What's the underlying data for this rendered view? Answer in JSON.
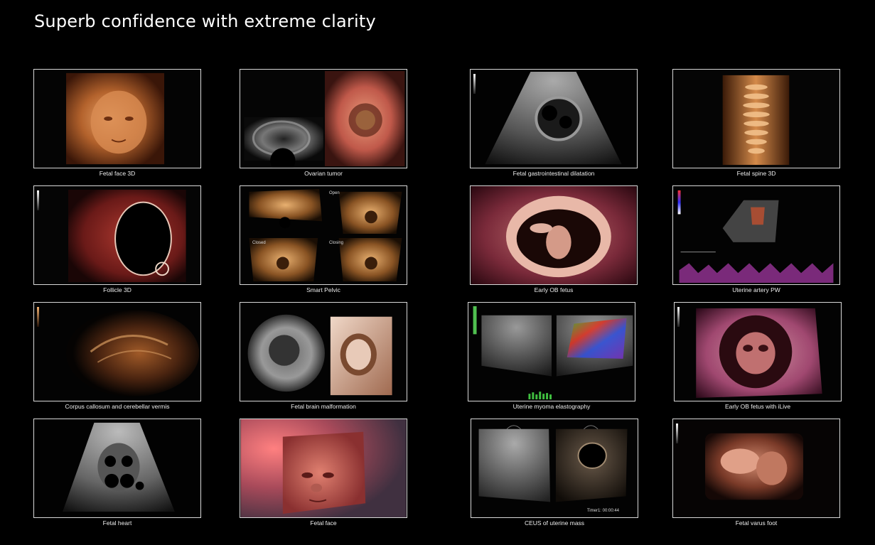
{
  "title": "Superb confidence with extreme clarity",
  "images": [
    {
      "caption": "Fetal face 3D"
    },
    {
      "caption": "Ovarian tumor"
    },
    {
      "caption": "Fetal gastrointestinal dilatation"
    },
    {
      "caption": "Fetal spine 3D"
    },
    {
      "caption": "Follicle 3D"
    },
    {
      "caption": "Smart Pelvic",
      "labels": [
        "Open",
        "Closed",
        "Closing"
      ]
    },
    {
      "caption": "Early OB fetus"
    },
    {
      "caption": "Uterine artery PW"
    },
    {
      "caption": "Corpus callosum and cerebellar vermis"
    },
    {
      "caption": "Fetal brain malformation"
    },
    {
      "caption": "Uterine myoma elastography"
    },
    {
      "caption": "Early OB fetus with iLive"
    },
    {
      "caption": "Fetal heart"
    },
    {
      "caption": "Fetal face"
    },
    {
      "caption": "CEUS of uterine mass",
      "timer": "Timer1: 00:00:44"
    },
    {
      "caption": "Fetal varus foot"
    }
  ]
}
